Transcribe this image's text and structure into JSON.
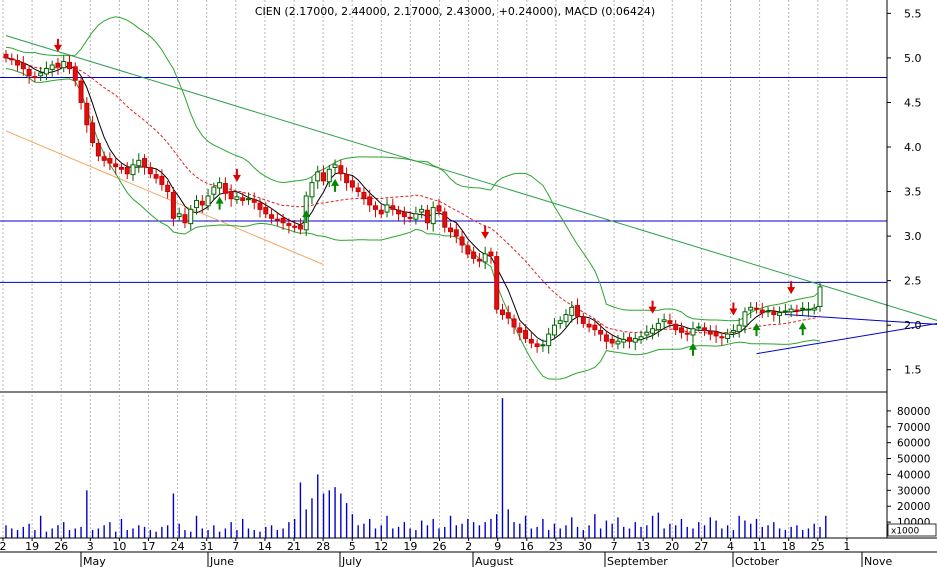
{
  "chart_data": {
    "type": "candlestick",
    "title": "CIEN (2.17000, 2.44000, 2.17000, 2.43000, +0.24000), MACD (0.06424)",
    "price_axis": {
      "min": 1.25,
      "max": 5.65,
      "ticks": [
        1.5,
        2.0,
        2.5,
        3.0,
        3.5,
        4.0,
        4.5,
        5.0,
        5.5
      ]
    },
    "volume_axis": {
      "min": 0,
      "max": 90000,
      "unit_label": "x1000",
      "ticks": [
        10000,
        20000,
        30000,
        40000,
        50000,
        60000,
        70000,
        80000
      ],
      "tick_labels": [
        "10000",
        "20000",
        "30000",
        "40000",
        "50000",
        "60000",
        "70000",
        "80000"
      ]
    },
    "x_axis": {
      "day_labels": [
        "2",
        "19",
        "26",
        "3",
        "10",
        "17",
        "24",
        "31",
        "7",
        "14",
        "21",
        "28",
        "5",
        "12",
        "19",
        "26",
        "2",
        "9",
        "16",
        "23",
        "30",
        "7",
        "13",
        "20",
        "27",
        "4",
        "11",
        "18",
        "25",
        "1"
      ],
      "month_labels": [
        "May",
        "June",
        "July",
        "August",
        "September",
        "October",
        "Nove"
      ]
    },
    "grid": true,
    "horizontal_lines": [
      4.78,
      3.17,
      2.48
    ],
    "trendlines": [
      {
        "color": "#2e9e4e",
        "from": [
          0,
          5.25
        ],
        "to": [
          170,
          1.88
        ]
      },
      {
        "color": "#f4a460",
        "from": [
          0,
          4.18
        ],
        "to": [
          55,
          2.68
        ]
      },
      {
        "color": "#0000cc",
        "from": [
          130,
          1.68
        ],
        "to": [
          190,
          2.33
        ]
      },
      {
        "color": "#0000cc",
        "from": [
          135,
          2.12
        ],
        "to": [
          175,
          1.95
        ]
      }
    ],
    "closes": [
      5.0,
      4.98,
      4.92,
      4.88,
      4.8,
      4.78,
      4.83,
      4.88,
      4.92,
      4.9,
      4.96,
      4.88,
      4.75,
      4.5,
      4.25,
      4.05,
      3.9,
      3.85,
      3.82,
      3.78,
      3.75,
      3.7,
      3.8,
      3.85,
      3.78,
      3.7,
      3.65,
      3.58,
      3.5,
      3.2,
      3.25,
      3.15,
      3.3,
      3.4,
      3.35,
      3.45,
      3.55,
      3.6,
      3.48,
      3.42,
      3.44,
      3.4,
      3.42,
      3.38,
      3.3,
      3.25,
      3.2,
      3.18,
      3.15,
      3.12,
      3.1,
      3.08,
      3.45,
      3.6,
      3.72,
      3.62,
      3.75,
      3.8,
      3.7,
      3.6,
      3.55,
      3.5,
      3.42,
      3.35,
      3.3,
      3.25,
      3.35,
      3.3,
      3.25,
      3.22,
      3.2,
      3.25,
      3.3,
      3.15,
      3.32,
      3.28,
      3.1,
      3.05,
      3.0,
      2.9,
      2.8,
      2.75,
      2.72,
      2.8,
      2.78,
      2.18,
      2.12,
      2.08,
      1.98,
      1.92,
      1.85,
      1.8,
      1.76,
      1.78,
      1.9,
      2.0,
      2.05,
      2.12,
      2.2,
      2.1,
      2.02,
      1.98,
      1.95,
      1.9,
      1.82,
      1.8,
      1.82,
      1.84,
      1.82,
      1.85,
      1.87,
      1.92,
      1.96,
      2.02,
      2.06,
      2.02,
      1.95,
      1.92,
      1.9,
      1.96,
      1.98,
      1.94,
      1.9,
      1.88,
      1.86,
      1.9,
      1.94,
      2.0,
      2.15,
      2.2,
      2.18,
      2.14,
      2.16,
      2.12,
      2.14,
      2.16,
      2.18,
      2.17,
      2.19,
      2.18,
      2.19,
      2.43
    ],
    "volumes": [
      8,
      6,
      5,
      7,
      9,
      5,
      14,
      4,
      6,
      8,
      10,
      5,
      6,
      7,
      30,
      5,
      6,
      8,
      10,
      4,
      12,
      5,
      6,
      8,
      7,
      5,
      4,
      7,
      8,
      28,
      9,
      5,
      4,
      14,
      6,
      5,
      8,
      4,
      6,
      10,
      5,
      12,
      6,
      5,
      4,
      7,
      8,
      5,
      6,
      10,
      12,
      35,
      18,
      25,
      40,
      28,
      30,
      32,
      28,
      22,
      15,
      8,
      9,
      12,
      6,
      8,
      14,
      6,
      7,
      10,
      6,
      5,
      11,
      8,
      12,
      6,
      7,
      14,
      8,
      9,
      12,
      10,
      8,
      10,
      12,
      15,
      88,
      18,
      10,
      9,
      14,
      6,
      7,
      12,
      5,
      9,
      6,
      8,
      13,
      7,
      5,
      8,
      15,
      6,
      11,
      9,
      13,
      7,
      6,
      10,
      7,
      8,
      14,
      16,
      6,
      9,
      8,
      12,
      7,
      6,
      10,
      8,
      13,
      11,
      6,
      8,
      5,
      14,
      11,
      9,
      12,
      7,
      8,
      10,
      6,
      5,
      7,
      8,
      5,
      6,
      9,
      7,
      14
    ]
  }
}
